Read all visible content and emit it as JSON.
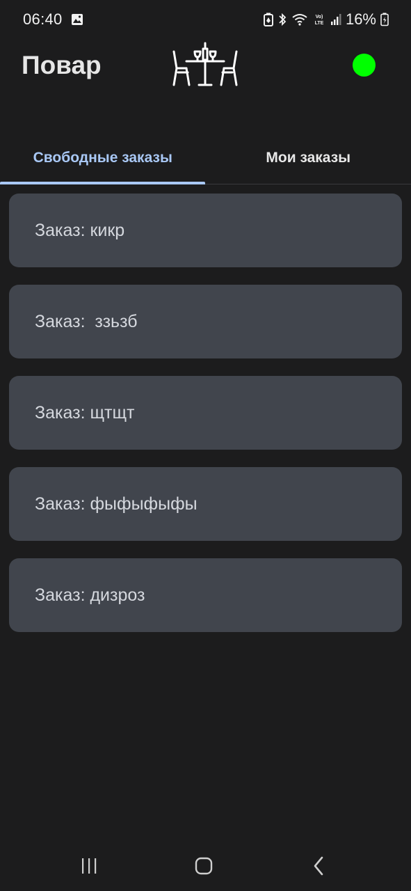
{
  "status_bar": {
    "time": "06:40",
    "battery": "16%",
    "icons": [
      "image-icon",
      "battery-saver-icon",
      "bluetooth-icon",
      "wifi-icon",
      "volte-icon",
      "signal-icon",
      "battery-icon"
    ]
  },
  "header": {
    "title": "Повар",
    "logo_icon": "restaurant-table-icon",
    "status_color": "#00ff00"
  },
  "tabs": [
    {
      "label": "Свободные заказы",
      "active": true
    },
    {
      "label": "Мои заказы",
      "active": false
    }
  ],
  "orders": [
    {
      "label": "Заказ: кикр"
    },
    {
      "label": "Заказ:  ззьзб"
    },
    {
      "label": "Заказ: щтщт"
    },
    {
      "label": "Заказ: фыфыфыфы"
    },
    {
      "label": "Заказ: дизроз"
    }
  ],
  "colors": {
    "background": "#1c1c1d",
    "card": "#41454d",
    "accent": "#a9c8f5",
    "online": "#00ff00"
  },
  "nav_bar": {
    "icons": [
      "recent-apps-icon",
      "home-icon",
      "back-icon"
    ]
  }
}
